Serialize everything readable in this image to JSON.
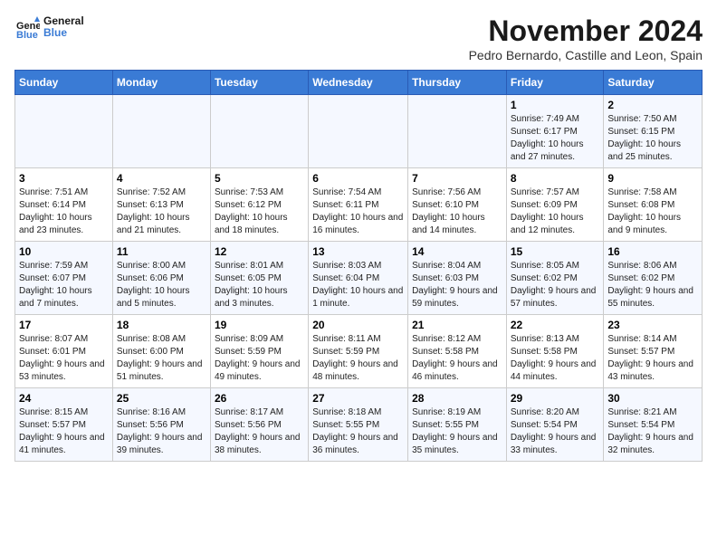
{
  "logo": {
    "text_general": "General",
    "text_blue": "Blue"
  },
  "title": "November 2024",
  "subtitle": "Pedro Bernardo, Castille and Leon, Spain",
  "headers": [
    "Sunday",
    "Monday",
    "Tuesday",
    "Wednesday",
    "Thursday",
    "Friday",
    "Saturday"
  ],
  "weeks": [
    [
      {
        "day": "",
        "info": ""
      },
      {
        "day": "",
        "info": ""
      },
      {
        "day": "",
        "info": ""
      },
      {
        "day": "",
        "info": ""
      },
      {
        "day": "",
        "info": ""
      },
      {
        "day": "1",
        "info": "Sunrise: 7:49 AM\nSunset: 6:17 PM\nDaylight: 10 hours and 27 minutes."
      },
      {
        "day": "2",
        "info": "Sunrise: 7:50 AM\nSunset: 6:15 PM\nDaylight: 10 hours and 25 minutes."
      }
    ],
    [
      {
        "day": "3",
        "info": "Sunrise: 7:51 AM\nSunset: 6:14 PM\nDaylight: 10 hours and 23 minutes."
      },
      {
        "day": "4",
        "info": "Sunrise: 7:52 AM\nSunset: 6:13 PM\nDaylight: 10 hours and 21 minutes."
      },
      {
        "day": "5",
        "info": "Sunrise: 7:53 AM\nSunset: 6:12 PM\nDaylight: 10 hours and 18 minutes."
      },
      {
        "day": "6",
        "info": "Sunrise: 7:54 AM\nSunset: 6:11 PM\nDaylight: 10 hours and 16 minutes."
      },
      {
        "day": "7",
        "info": "Sunrise: 7:56 AM\nSunset: 6:10 PM\nDaylight: 10 hours and 14 minutes."
      },
      {
        "day": "8",
        "info": "Sunrise: 7:57 AM\nSunset: 6:09 PM\nDaylight: 10 hours and 12 minutes."
      },
      {
        "day": "9",
        "info": "Sunrise: 7:58 AM\nSunset: 6:08 PM\nDaylight: 10 hours and 9 minutes."
      }
    ],
    [
      {
        "day": "10",
        "info": "Sunrise: 7:59 AM\nSunset: 6:07 PM\nDaylight: 10 hours and 7 minutes."
      },
      {
        "day": "11",
        "info": "Sunrise: 8:00 AM\nSunset: 6:06 PM\nDaylight: 10 hours and 5 minutes."
      },
      {
        "day": "12",
        "info": "Sunrise: 8:01 AM\nSunset: 6:05 PM\nDaylight: 10 hours and 3 minutes."
      },
      {
        "day": "13",
        "info": "Sunrise: 8:03 AM\nSunset: 6:04 PM\nDaylight: 10 hours and 1 minute."
      },
      {
        "day": "14",
        "info": "Sunrise: 8:04 AM\nSunset: 6:03 PM\nDaylight: 9 hours and 59 minutes."
      },
      {
        "day": "15",
        "info": "Sunrise: 8:05 AM\nSunset: 6:02 PM\nDaylight: 9 hours and 57 minutes."
      },
      {
        "day": "16",
        "info": "Sunrise: 8:06 AM\nSunset: 6:02 PM\nDaylight: 9 hours and 55 minutes."
      }
    ],
    [
      {
        "day": "17",
        "info": "Sunrise: 8:07 AM\nSunset: 6:01 PM\nDaylight: 9 hours and 53 minutes."
      },
      {
        "day": "18",
        "info": "Sunrise: 8:08 AM\nSunset: 6:00 PM\nDaylight: 9 hours and 51 minutes."
      },
      {
        "day": "19",
        "info": "Sunrise: 8:09 AM\nSunset: 5:59 PM\nDaylight: 9 hours and 49 minutes."
      },
      {
        "day": "20",
        "info": "Sunrise: 8:11 AM\nSunset: 5:59 PM\nDaylight: 9 hours and 48 minutes."
      },
      {
        "day": "21",
        "info": "Sunrise: 8:12 AM\nSunset: 5:58 PM\nDaylight: 9 hours and 46 minutes."
      },
      {
        "day": "22",
        "info": "Sunrise: 8:13 AM\nSunset: 5:58 PM\nDaylight: 9 hours and 44 minutes."
      },
      {
        "day": "23",
        "info": "Sunrise: 8:14 AM\nSunset: 5:57 PM\nDaylight: 9 hours and 43 minutes."
      }
    ],
    [
      {
        "day": "24",
        "info": "Sunrise: 8:15 AM\nSunset: 5:57 PM\nDaylight: 9 hours and 41 minutes."
      },
      {
        "day": "25",
        "info": "Sunrise: 8:16 AM\nSunset: 5:56 PM\nDaylight: 9 hours and 39 minutes."
      },
      {
        "day": "26",
        "info": "Sunrise: 8:17 AM\nSunset: 5:56 PM\nDaylight: 9 hours and 38 minutes."
      },
      {
        "day": "27",
        "info": "Sunrise: 8:18 AM\nSunset: 5:55 PM\nDaylight: 9 hours and 36 minutes."
      },
      {
        "day": "28",
        "info": "Sunrise: 8:19 AM\nSunset: 5:55 PM\nDaylight: 9 hours and 35 minutes."
      },
      {
        "day": "29",
        "info": "Sunrise: 8:20 AM\nSunset: 5:54 PM\nDaylight: 9 hours and 33 minutes."
      },
      {
        "day": "30",
        "info": "Sunrise: 8:21 AM\nSunset: 5:54 PM\nDaylight: 9 hours and 32 minutes."
      }
    ]
  ]
}
